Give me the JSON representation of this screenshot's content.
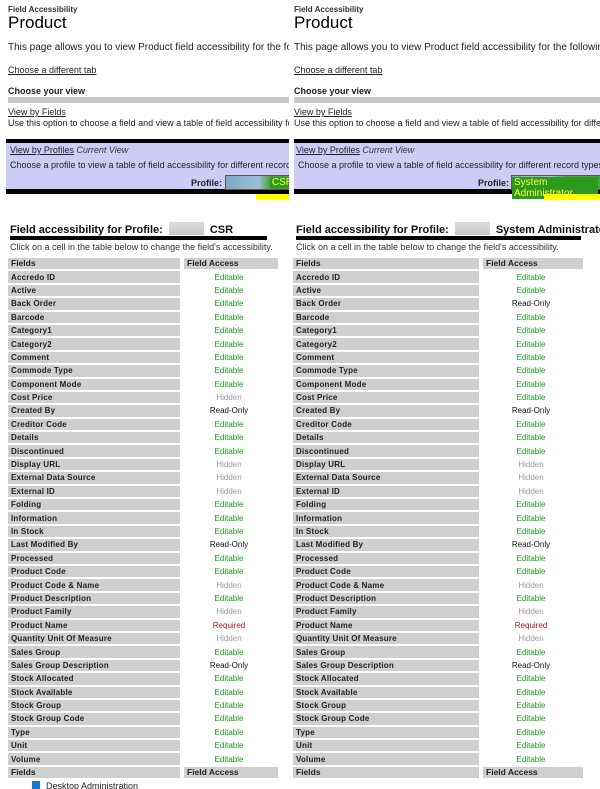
{
  "panels": [
    {
      "breadcrumb": "Field Accessibility",
      "title": "Product",
      "intro": "This page allows you to view Product field accessibility for the following profiles",
      "choose_tab_link": "Choose a different tab",
      "choose_view_heading": "Choose your view",
      "view_by_fields": {
        "link": "View by Fields",
        "description": "Use this option to choose a field and view a table of field accessibility for different record types."
      },
      "view_by_profiles": {
        "link": "View by Profiles",
        "current_label": "Current View",
        "description": "Choose a profile to view a table of field accessibility for different record types.",
        "profile_label": "Profile:",
        "profile_value": "CSR"
      },
      "section_title_prefix": "Field accessibility for Profile:",
      "section_profile": "CSR",
      "instructions": "Click on a cell in the table below to change the field's accessibility.",
      "columns": [
        "Fields",
        "Field Access"
      ],
      "rows": [
        {
          "field": "Accredo ID",
          "access": "Editable"
        },
        {
          "field": "Active",
          "access": "Editable"
        },
        {
          "field": "Back Order",
          "access": "Editable"
        },
        {
          "field": "Barcode",
          "access": "Editable"
        },
        {
          "field": "Category1",
          "access": "Editable"
        },
        {
          "field": "Category2",
          "access": "Editable"
        },
        {
          "field": "Comment",
          "access": "Editable"
        },
        {
          "field": "Commode Type",
          "access": "Editable"
        },
        {
          "field": "Component Mode",
          "access": "Editable"
        },
        {
          "field": "Cost Price",
          "access": "Hidden"
        },
        {
          "field": "Created By",
          "access": "Read-Only"
        },
        {
          "field": "Creditor Code",
          "access": "Editable"
        },
        {
          "field": "Details",
          "access": "Editable"
        },
        {
          "field": "Discontinued",
          "access": "Editable"
        },
        {
          "field": "Display URL",
          "access": "Hidden"
        },
        {
          "field": "External Data Source",
          "access": "Hidden"
        },
        {
          "field": "External ID",
          "access": "Hidden"
        },
        {
          "field": "Folding",
          "access": "Editable"
        },
        {
          "field": "Information",
          "access": "Editable"
        },
        {
          "field": "In Stock",
          "access": "Editable"
        },
        {
          "field": "Last Modified By",
          "access": "Read-Only"
        },
        {
          "field": "Processed",
          "access": "Editable"
        },
        {
          "field": "Product Code",
          "access": "Editable"
        },
        {
          "field": "Product Code & Name",
          "access": "Hidden"
        },
        {
          "field": "Product Description",
          "access": "Editable"
        },
        {
          "field": "Product Family",
          "access": "Hidden"
        },
        {
          "field": "Product Name",
          "access": "Required"
        },
        {
          "field": "Quantity Unit Of Measure",
          "access": "Hidden"
        },
        {
          "field": "Sales Group",
          "access": "Editable"
        },
        {
          "field": "Sales Group Description",
          "access": "Read-Only"
        },
        {
          "field": "Stock Allocated",
          "access": "Editable"
        },
        {
          "field": "Stock Available",
          "access": "Editable"
        },
        {
          "field": "Stock Group",
          "access": "Editable"
        },
        {
          "field": "Stock Group Code",
          "access": "Editable"
        },
        {
          "field": "Type",
          "access": "Editable"
        },
        {
          "field": "Unit",
          "access": "Editable"
        },
        {
          "field": "Volume",
          "access": "Editable"
        }
      ]
    },
    {
      "breadcrumb": "Field Accessibility",
      "title": "Product",
      "intro": "This page allows you to view Product field accessibility for the following profiles",
      "choose_tab_link": "Choose a different tab",
      "choose_view_heading": "Choose your view",
      "view_by_fields": {
        "link": "View by Fields",
        "description": "Use this option to choose a field and view a table of field accessibility for different record types."
      },
      "view_by_profiles": {
        "link": "View by Profiles",
        "current_label": "Current View",
        "description": "Choose a profile to view a table of field accessibility for different record types.",
        "profile_label": "Profile:",
        "profile_value": "System Administrator"
      },
      "section_title_prefix": "Field accessibility for Profile:",
      "section_profile": "System Administrator",
      "instructions": "Click on a cell in the table below to change the field's accessibility.",
      "columns": [
        "Fields",
        "Field Access"
      ],
      "rows": [
        {
          "field": "Accredo ID",
          "access": "Editable"
        },
        {
          "field": "Active",
          "access": "Editable"
        },
        {
          "field": "Back Order",
          "access": "Read-Only"
        },
        {
          "field": "Barcode",
          "access": "Editable"
        },
        {
          "field": "Category1",
          "access": "Editable"
        },
        {
          "field": "Category2",
          "access": "Editable"
        },
        {
          "field": "Comment",
          "access": "Editable"
        },
        {
          "field": "Commode Type",
          "access": "Editable"
        },
        {
          "field": "Component Mode",
          "access": "Editable"
        },
        {
          "field": "Cost Price",
          "access": "Editable"
        },
        {
          "field": "Created By",
          "access": "Read-Only"
        },
        {
          "field": "Creditor Code",
          "access": "Editable"
        },
        {
          "field": "Details",
          "access": "Editable"
        },
        {
          "field": "Discontinued",
          "access": "Editable"
        },
        {
          "field": "Display URL",
          "access": "Hidden"
        },
        {
          "field": "External Data Source",
          "access": "Hidden"
        },
        {
          "field": "External ID",
          "access": "Hidden"
        },
        {
          "field": "Folding",
          "access": "Editable"
        },
        {
          "field": "Information",
          "access": "Editable"
        },
        {
          "field": "In Stock",
          "access": "Editable"
        },
        {
          "field": "Last Modified By",
          "access": "Read-Only"
        },
        {
          "field": "Processed",
          "access": "Editable"
        },
        {
          "field": "Product Code",
          "access": "Editable"
        },
        {
          "field": "Product Code & Name",
          "access": "Hidden"
        },
        {
          "field": "Product Description",
          "access": "Editable"
        },
        {
          "field": "Product Family",
          "access": "Hidden"
        },
        {
          "field": "Product Name",
          "access": "Required"
        },
        {
          "field": "Quantity Unit Of Measure",
          "access": "Hidden"
        },
        {
          "field": "Sales Group",
          "access": "Editable"
        },
        {
          "field": "Sales Group Description",
          "access": "Read-Only"
        },
        {
          "field": "Stock Allocated",
          "access": "Editable"
        },
        {
          "field": "Stock Available",
          "access": "Editable"
        },
        {
          "field": "Stock Group",
          "access": "Editable"
        },
        {
          "field": "Stock Group Code",
          "access": "Editable"
        },
        {
          "field": "Type",
          "access": "Editable"
        },
        {
          "field": "Unit",
          "access": "Editable"
        },
        {
          "field": "Volume",
          "access": "Editable"
        }
      ]
    }
  ],
  "taskbar": {
    "item_label": "Desktop Administration"
  },
  "access_colors": {
    "Editable": "#1a9a1a",
    "Hidden": "#999999",
    "Read-Only": "#111111",
    "Required": "#a01818"
  }
}
